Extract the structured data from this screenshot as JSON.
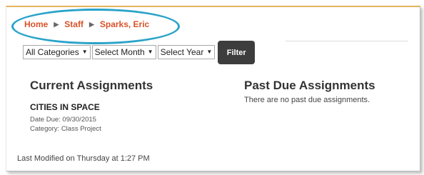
{
  "breadcrumb": {
    "items": [
      "Home",
      "Staff",
      "Sparks, Eric"
    ]
  },
  "filters": {
    "category": "All Categories",
    "month": "Select Month",
    "year": "Select Year",
    "filter_label": "Filter"
  },
  "current": {
    "title": "Current Assignments",
    "assignment": {
      "name": "CITIES IN SPACE",
      "due": "Date Due: 09/30/2015",
      "category": "Category: Class Project"
    }
  },
  "past_due": {
    "title": "Past Due Assignments",
    "message": "There are no past due assignments."
  },
  "footer": {
    "modified": "Last Modified on Thursday at 1:27 PM"
  },
  "colors": {
    "accent": "#d9532b",
    "highlight": "#2aa3c9",
    "button": "#3d3d3d"
  }
}
